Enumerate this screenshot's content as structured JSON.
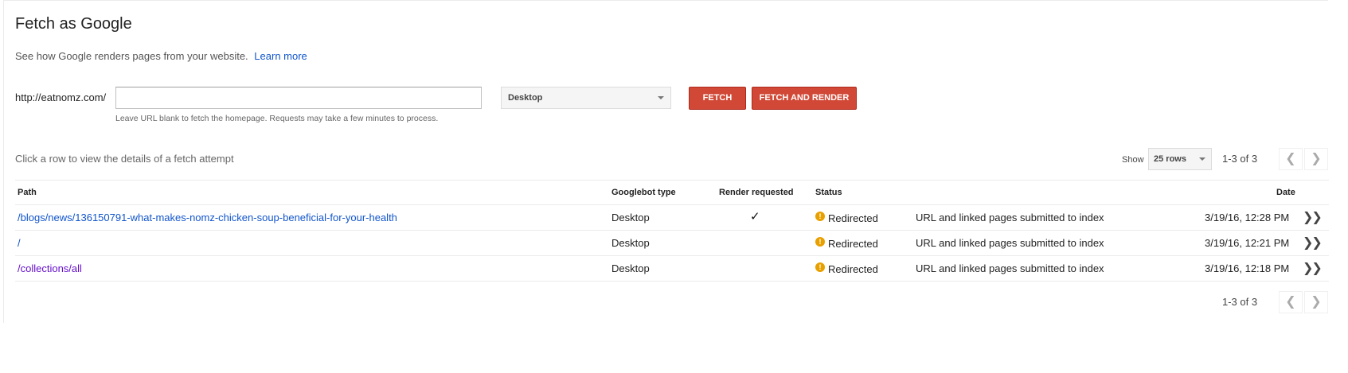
{
  "header": {
    "title": "Fetch as Google",
    "description": "See how Google renders pages from your website.",
    "learn_more": "Learn more"
  },
  "fetch_form": {
    "base_url": "http://eatnomz.com/",
    "url_value": "",
    "hint": "Leave URL blank to fetch the homepage. Requests may take a few minutes to process.",
    "device_selected": "Desktop",
    "fetch_label": "Fetch",
    "fetch_render_label": "Fetch and Render",
    "button_color": "#d14836"
  },
  "results": {
    "row_hint": "Click a row to view the details of a fetch attempt",
    "show_label": "Show",
    "rows_selected": "25 rows",
    "pager_top": "1-3 of 3",
    "pager_bottom": "1-3 of 3",
    "columns": {
      "path": "Path",
      "bot_type": "Googlebot type",
      "render": "Render requested",
      "status": "Status",
      "date": "Date"
    },
    "rows": [
      {
        "path": "/blogs/news/136150791-what-makes-nomz-chicken-soup-beneficial-for-your-health",
        "bot_type": "Desktop",
        "render": "✓",
        "status": "Redirected",
        "submitted": "URL and linked pages submitted to index",
        "date": "3/19/16, 12:28 PM"
      },
      {
        "path": "/",
        "bot_type": "Desktop",
        "render": "",
        "status": "Redirected",
        "submitted": "URL and linked pages submitted to index",
        "date": "3/19/16, 12:21 PM"
      },
      {
        "path": "/collections/all",
        "bot_type": "Desktop",
        "render": "",
        "status": "Redirected",
        "submitted": "URL and linked pages submitted to index",
        "date": "3/19/16, 12:18 PM"
      }
    ]
  },
  "icons": {
    "warning": "warning-icon",
    "expand": "chevron-double-right-icon",
    "prev": "chevron-left-icon",
    "next": "chevron-right-icon"
  },
  "colors": {
    "link": "#1155cc",
    "visited_link": "#6611cc",
    "warning": "#e8a000"
  }
}
